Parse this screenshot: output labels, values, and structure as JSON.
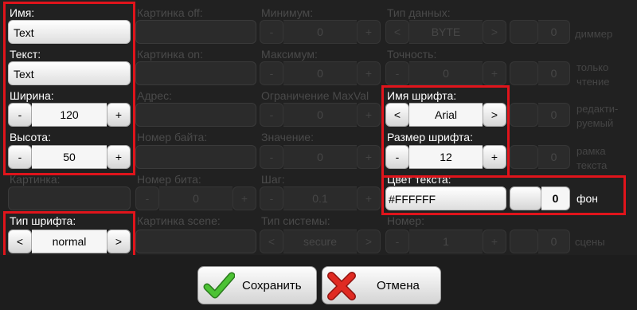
{
  "col1": {
    "name": {
      "label": "Имя:",
      "value": "Text"
    },
    "text": {
      "label": "Текст:",
      "value": "Text"
    },
    "width": {
      "label": "Ширина:",
      "minus": "-",
      "value": "120",
      "plus": "+"
    },
    "height": {
      "label": "Высота:",
      "minus": "-",
      "value": "50",
      "plus": "+"
    },
    "picture": {
      "label": "Картинка:"
    },
    "font_type": {
      "label": "Тип шрифта:",
      "prev": "<",
      "value": "normal",
      "next": ">"
    }
  },
  "col2": {
    "picture_off": {
      "label": "Картинка off:"
    },
    "picture_on": {
      "label": "Картинка on:"
    },
    "address": {
      "label": "Адрес:"
    },
    "byte_number": {
      "label": "Номер байта:"
    },
    "bit_number": {
      "label": "Номер бита:",
      "minus": "-",
      "value": "0",
      "plus": "+"
    },
    "picture_scene": {
      "label": "Картинка scene:"
    }
  },
  "col3": {
    "minimum": {
      "label": "Минимум:",
      "minus": "-",
      "value": "0",
      "plus": "+"
    },
    "maximum": {
      "label": "Максимум:",
      "minus": "-",
      "value": "0",
      "plus": "+"
    },
    "limit_max": {
      "label": "Ограничение MaxVal",
      "minus": "-",
      "value": "0",
      "plus": "+"
    },
    "value": {
      "label": "Значение:",
      "minus": "-",
      "value": "0",
      "plus": "+"
    },
    "step": {
      "label": "Шаг:",
      "minus": "-",
      "value": "0.1",
      "plus": "+"
    },
    "system_type": {
      "label": "Тип системы:",
      "prev": "<",
      "value": "secure",
      "next": ">"
    }
  },
  "col4": {
    "data_type": {
      "label": "Тип данных:",
      "prev": "<",
      "value": "BYTE",
      "next": ">"
    },
    "precision": {
      "label": "Точность:",
      "minus": "-",
      "value": "0",
      "plus": "+"
    },
    "font_name": {
      "label": "Имя шрифта:",
      "prev": "<",
      "value": "Arial",
      "next": ">"
    },
    "font_size": {
      "label": "Размер шрифта:",
      "minus": "-",
      "value": "12",
      "plus": "+"
    },
    "text_color": {
      "label": "Цвет текста:",
      "value": "#FFFFFF"
    },
    "number": {
      "label": "Номер:",
      "minus": "-",
      "value": "1",
      "plus": "+"
    }
  },
  "col5": {
    "dimmer": {
      "value": "0",
      "label": "диммер"
    },
    "readonly": {
      "value": "0",
      "label_line1": "только",
      "label_line2": "чтение"
    },
    "editable": {
      "value": "0",
      "label_line1": "редакти-",
      "label_line2": "руемый"
    },
    "text_frame": {
      "value": "0",
      "label_line1": "рамка",
      "label_line2": "текста"
    },
    "background": {
      "value": "0",
      "label": "фон"
    },
    "scenes": {
      "value": "0",
      "label": "сцены"
    }
  },
  "footer": {
    "save_label": "Сохранить",
    "cancel_label": "Отмена"
  },
  "colors": {
    "highlight": "#e0141b",
    "save_icon": "#3fae2a",
    "cancel_icon": "#d8201c",
    "background": "#212121"
  }
}
